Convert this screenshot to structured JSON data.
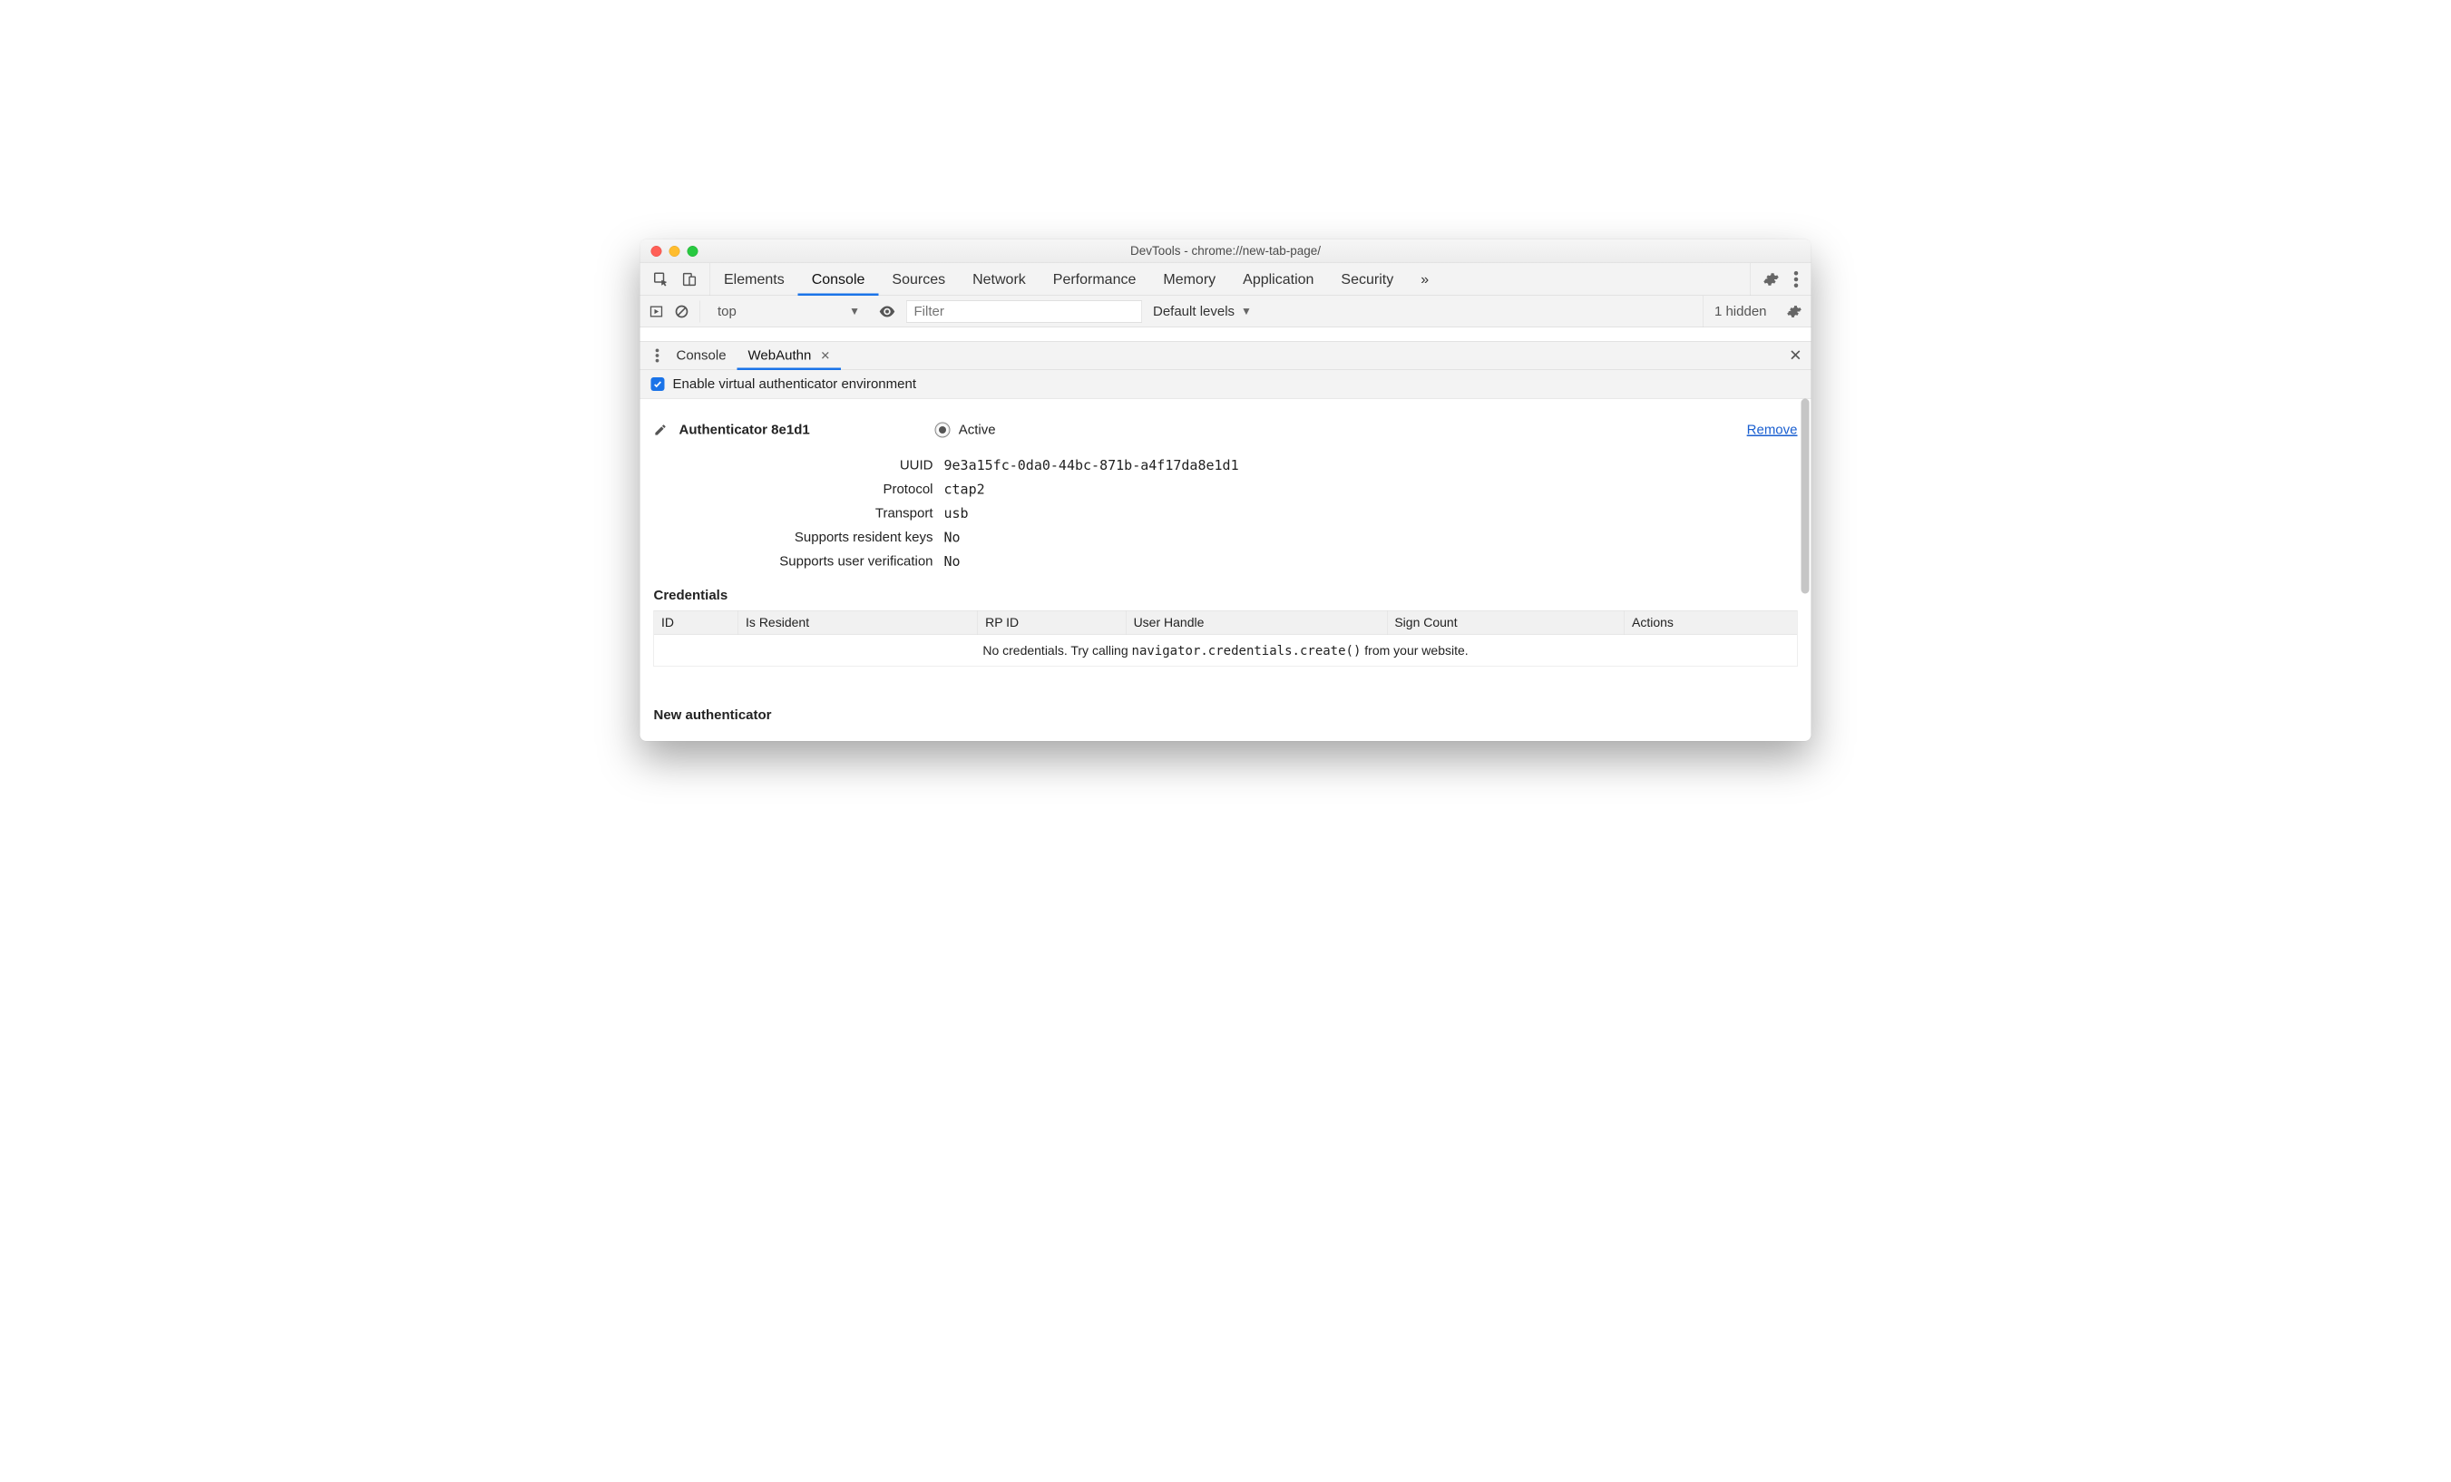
{
  "window": {
    "title": "DevTools - chrome://new-tab-page/"
  },
  "main_tabs": {
    "items": [
      "Elements",
      "Console",
      "Sources",
      "Network",
      "Performance",
      "Memory",
      "Application",
      "Security"
    ],
    "active_index": 1,
    "overflow_glyph": "»"
  },
  "console_bar": {
    "context": "top",
    "filter_placeholder": "Filter",
    "levels_label": "Default levels",
    "hidden_text": "1 hidden"
  },
  "drawer": {
    "tabs": [
      "Console",
      "WebAuthn"
    ],
    "active_index": 1,
    "close_glyph": "✕"
  },
  "enable": {
    "label": "Enable virtual authenticator environment",
    "checked": true
  },
  "authenticator": {
    "title": "Authenticator 8e1d1",
    "active_label": "Active",
    "remove_label": "Remove",
    "fields": {
      "uuid_label": "UUID",
      "uuid": "9e3a15fc-0da0-44bc-871b-a4f17da8e1d1",
      "protocol_label": "Protocol",
      "protocol": "ctap2",
      "transport_label": "Transport",
      "transport": "usb",
      "resident_label": "Supports resident keys",
      "resident": "No",
      "uv_label": "Supports user verification",
      "uv": "No"
    }
  },
  "credentials": {
    "heading": "Credentials",
    "columns": [
      "ID",
      "Is Resident",
      "RP ID",
      "User Handle",
      "Sign Count",
      "Actions"
    ],
    "empty_prefix": "No credentials. Try calling ",
    "empty_code": "navigator.credentials.create()",
    "empty_suffix": " from your website."
  },
  "new_auth": {
    "heading": "New authenticator"
  }
}
